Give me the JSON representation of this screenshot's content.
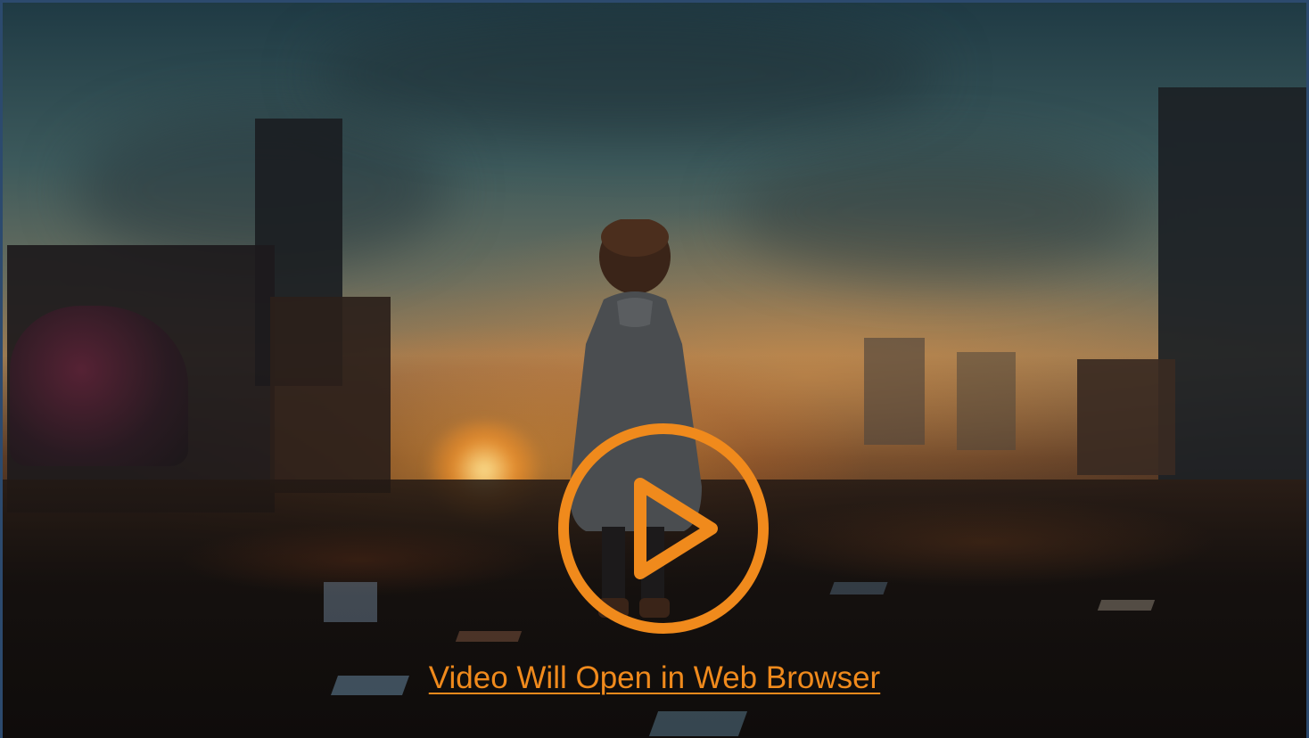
{
  "slide": {
    "link_text": "Video Will Open in Web Browser",
    "play_icon": "play-circle-icon",
    "accent_color": "#f08a1c",
    "background_description_icon": "video-thumbnail-image"
  }
}
